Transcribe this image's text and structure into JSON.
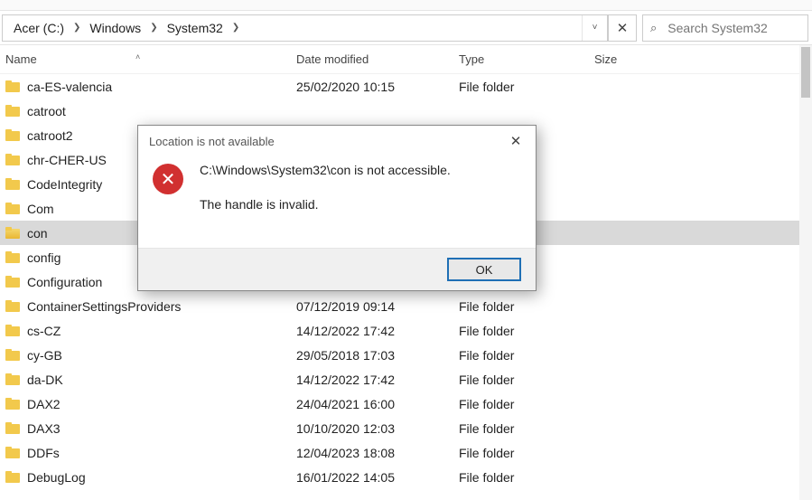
{
  "breadcrumb": {
    "items": [
      "Acer (C:)",
      "Windows",
      "System32"
    ]
  },
  "search": {
    "placeholder": "Search System32"
  },
  "columns": {
    "name": "Name",
    "date": "Date modified",
    "type": "Type",
    "size": "Size"
  },
  "selected_index": 6,
  "rows": [
    {
      "name": "ca-ES-valencia",
      "date": "25/02/2020 10:15",
      "type": "File folder"
    },
    {
      "name": "catroot",
      "date": "",
      "type": ""
    },
    {
      "name": "catroot2",
      "date": "",
      "type": ""
    },
    {
      "name": "chr-CHER-US",
      "date": "",
      "type": ""
    },
    {
      "name": "CodeIntegrity",
      "date": "",
      "type": ""
    },
    {
      "name": "Com",
      "date": "",
      "type": ""
    },
    {
      "name": "con",
      "date": "",
      "type": ""
    },
    {
      "name": "config",
      "date": "",
      "type": ""
    },
    {
      "name": "Configuration",
      "date": "",
      "type": ""
    },
    {
      "name": "ContainerSettingsProviders",
      "date": "07/12/2019 09:14",
      "type": "File folder"
    },
    {
      "name": "cs-CZ",
      "date": "14/12/2022 17:42",
      "type": "File folder"
    },
    {
      "name": "cy-GB",
      "date": "29/05/2018 17:03",
      "type": "File folder"
    },
    {
      "name": "da-DK",
      "date": "14/12/2022 17:42",
      "type": "File folder"
    },
    {
      "name": "DAX2",
      "date": "24/04/2021 16:00",
      "type": "File folder"
    },
    {
      "name": "DAX3",
      "date": "10/10/2020 12:03",
      "type": "File folder"
    },
    {
      "name": "DDFs",
      "date": "12/04/2023 18:08",
      "type": "File folder"
    },
    {
      "name": "DebugLog",
      "date": "16/01/2022 14:05",
      "type": "File folder"
    }
  ],
  "dialog": {
    "title": "Location is not available",
    "line1": "C:\\Windows\\System32\\con is not accessible.",
    "line2": "The handle is invalid.",
    "ok": "OK"
  }
}
